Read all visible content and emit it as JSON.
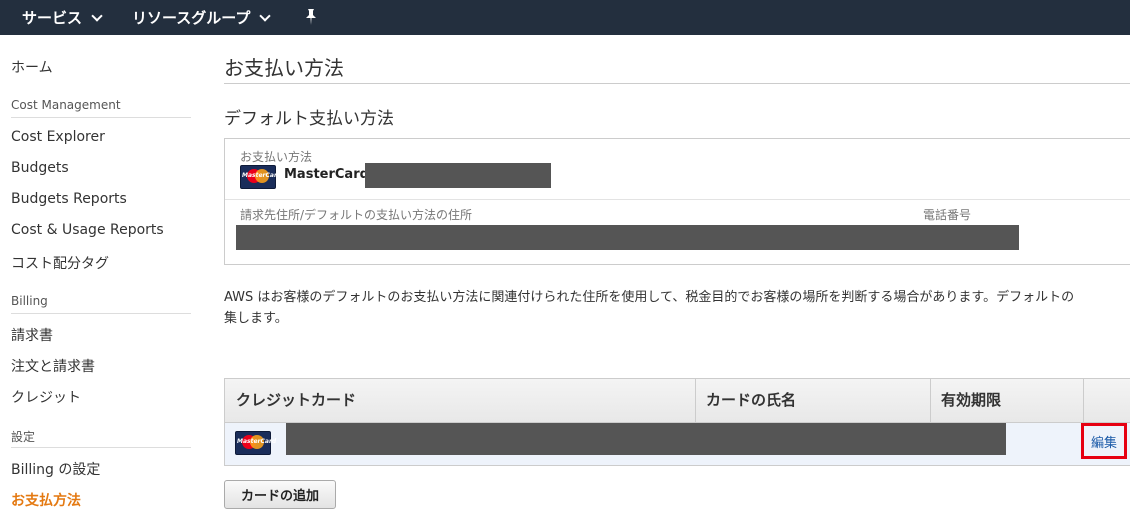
{
  "topbar": {
    "services": "サービス",
    "resource_groups": "リソースグループ"
  },
  "sidebar": {
    "home": "ホーム",
    "cost_management": {
      "heading": "Cost Management",
      "items": [
        "Cost Explorer",
        "Budgets",
        "Budgets Reports",
        "Cost & Usage Reports",
        "コスト配分タグ"
      ]
    },
    "billing": {
      "heading": "Billing",
      "items": [
        "請求書",
        "注文と請求書",
        "クレジット"
      ]
    },
    "settings": {
      "heading": "設定",
      "items": [
        "Billing の設定",
        "お支払方法"
      ]
    }
  },
  "main": {
    "title": "お支払い方法",
    "default_section": {
      "title": "デフォルト支払い方法",
      "payment_method_label": "お支払い方法",
      "card_brand": "MasterCard",
      "card_logo_text": "MasterCard",
      "billing_address_label": "請求先住所/デフォルトの支払い方法の住所",
      "phone_label": "電話番号"
    },
    "note_line1": "AWS はお客様のデフォルトのお支払い方法に関連付けられた住所を使用して、税金目的でお客様の場所を判断する場合があります。デフォルトの",
    "note_line2": "集します。",
    "table": {
      "headers": [
        "クレジットカード",
        "カードの氏名",
        "有効期限"
      ],
      "row": {
        "card_logo_text": "MasterCard",
        "edit_link": "編集"
      }
    },
    "add_card_button": "カードの追加"
  },
  "colors": {
    "topbar_bg": "#232f3e",
    "active_nav": "#e47911",
    "link": "#1a5aa8",
    "highlight_border": "#e60012"
  }
}
